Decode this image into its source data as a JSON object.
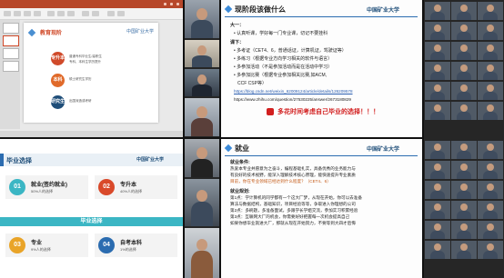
{
  "slide1": {
    "title": "教育现阶",
    "logo": "中国矿业大学",
    "circles": [
      "专升本",
      "本科",
      "研究生"
    ],
    "lines": [
      "普通专科毕业生/高职生",
      "专科、本科生学历提升",
      "硕士研究生学历",
      "出国深造或考研"
    ]
  },
  "career": {
    "title": "毕业选择",
    "logo": "中国矿业大学",
    "banner": "毕业选择",
    "boxes": [
      {
        "num": "01",
        "title": "就业(签约就业)",
        "sub": "50%人的选择",
        "color": "#3bb6c4"
      },
      {
        "num": "02",
        "title": "专升本",
        "sub": "40%人的选择",
        "color": "#d9492a"
      },
      {
        "num": "03",
        "title": "专业",
        "sub": "9%人的选择",
        "color": "#e9a428"
      },
      {
        "num": "04",
        "title": "自考本科",
        "sub": "1%的选择",
        "color": "#2b6cb0"
      }
    ]
  },
  "doc1": {
    "title": "现阶段该做什么",
    "logo": "中国矿业大学",
    "l1": "大一：",
    "l2": "• 认真听课，学好每一门专业课，切记不要挂科",
    "l3": "课下：",
    "l4": "• 多考证（CET4、6，普通话证，计算机证，驾驶证等）",
    "l5": "• 多练习（根据专业方向学习相关的软件与语言）",
    "l6": "• 多参加活动（不是参加活动而是在活动中学习）",
    "l7": "• 多参加比赛（根据专业参加相关比赛,如ACM,",
    "l8": "CCF CSP等）",
    "link1": "https://blog.csdn.net/weixin_62009124/article/details/126209578",
    "link2": "https://www.zhihu.com/question/27530225/answer/2673180829",
    "red": "多花时间考虑自己毕业的选择！！！"
  },
  "doc2": {
    "title": "就业",
    "logo": "中国矿业大学",
    "h1": "就业条件:",
    "p1": "热爱本专业并愿意为之奋斗，编程基础扎实，具备优秀的业务能力与",
    "p2": "有良好的技术视野，能深入理解技术核心原理，能快速提升专业素质",
    "p3": "目前，你在专业领域已经达到什么程度？（CET4、6）",
    "h2": "就业规划:",
    "q1": "第1点：学计算机的同学都有一个这大厂梦，从现在开始，你可以去准备",
    "q2": "算法与数据结构，基础知识，项目经验等等，争取进入你理想的公司",
    "q3": "第2点：多刷题，多准备面试，多跟学长学姐交流，参加实习积累经验",
    "q4": "第3点：互联网大厂的机会，你需要好好把握每一次机会提高自己",
    "q5": "如果你想毕业就进大厂，那就从现在开始努力，不要等到大四才后悔"
  }
}
